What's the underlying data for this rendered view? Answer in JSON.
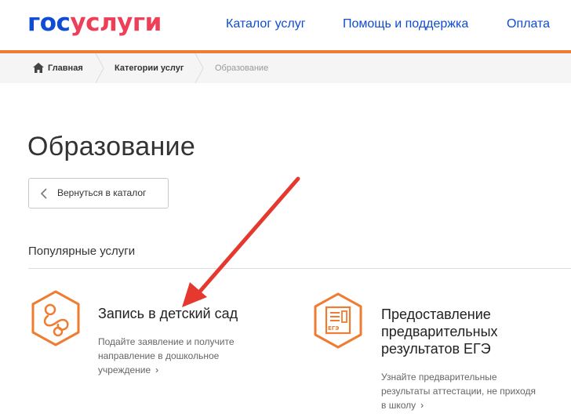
{
  "header": {
    "logo_part1": "гос",
    "logo_part2": "услуги",
    "nav": [
      "Каталог услуг",
      "Помощь и поддержка",
      "Оплата"
    ]
  },
  "breadcrumb": {
    "home": "Главная",
    "categories": "Категории услуг",
    "current": "Образование"
  },
  "page": {
    "title": "Образование",
    "back_label": "Вернуться в каталог",
    "section_title": "Популярные услуги"
  },
  "services": [
    {
      "icon": "pacifier-icon",
      "title": "Запись в детский сад",
      "desc_lines": [
        "Подайте заявление и получите",
        "направление в дошкольное",
        "учреждение"
      ]
    },
    {
      "icon": "ege-certificate-icon",
      "title_lines": [
        "Предоставление",
        "предварительных",
        "результатов ЕГЭ"
      ],
      "desc_lines": [
        "Узнайте предварительные",
        "результаты аттестации, не приходя",
        "в школу"
      ]
    }
  ],
  "colors": {
    "brand_blue": "#0d4cd3",
    "brand_red": "#ee3f58",
    "accent_orange": "#ef7d31",
    "annotation_red": "#e5392f"
  }
}
